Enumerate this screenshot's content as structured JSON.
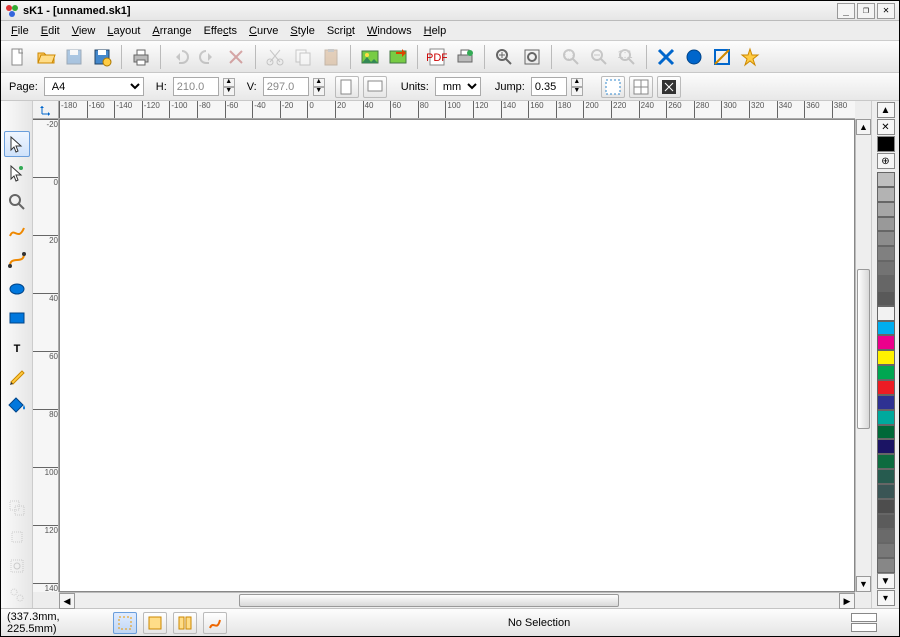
{
  "title": "sK1 - [unnamed.sk1]",
  "menu": [
    "File",
    "Edit",
    "View",
    "Layout",
    "Arrange",
    "Effects",
    "Curve",
    "Style",
    "Script",
    "Windows",
    "Help"
  ],
  "toolbar1": {
    "new": "doc-new-icon",
    "open": "doc-open-icon",
    "save": "doc-save-icon",
    "saveas": "doc-saveas-icon",
    "print": "print-icon",
    "undo": "undo-icon",
    "redo": "redo-icon",
    "delete": "delete-icon",
    "cut": "cut-icon",
    "copy": "copy-icon",
    "paste": "paste-icon",
    "import": "import-image-icon",
    "export": "export-image-icon",
    "pdf": "pdf-export-icon",
    "printps": "print-ps-icon",
    "zoomin": "zoom-in-icon",
    "zoomfit": "zoom-fit-icon",
    "zoomsel": "zoom-selection-icon",
    "zoomout": "zoom-out-icon",
    "zoom100": "zoom-100-icon",
    "nofill": "no-fill-icon",
    "fill": "fill-icon",
    "outline": "outline-icon",
    "star": "favorite-icon"
  },
  "propbar": {
    "page_label": "Page:",
    "page_value": "A4",
    "h_label": "H:",
    "h_value": "210.0",
    "v_label": "V:",
    "v_value": "297.0",
    "portrait": "portrait-icon",
    "landscape": "landscape-icon",
    "units_label": "Units:",
    "units_value": "mm",
    "jump_label": "Jump:",
    "jump_value": "0.35",
    "guides": "guides-icon",
    "snapgrid": "snap-grid-icon",
    "snapobj": "snap-object-icon"
  },
  "tools": {
    "select": "select-tool",
    "shaper": "shaper-tool",
    "zoom": "zoom-tool",
    "freehand": "freehand-tool",
    "bezier": "bezier-tool",
    "ellipse": "ellipse-tool",
    "rect": "rectangle-tool",
    "text": "text-tool",
    "outline": "outline-tool",
    "fill": "fill-tool",
    "d1": "combine-tool",
    "d2": "break-tool",
    "d3": "group-tool",
    "d4": "ungroup-tool"
  },
  "ruler": {
    "h_start": -180,
    "h_end": 400,
    "h_step": 20,
    "v_start": -20,
    "v_end": 140,
    "v_step": 20
  },
  "palette": [
    "#bfbfbf",
    "#b3b3b3",
    "#a6a6a6",
    "#999999",
    "#8c8c8c",
    "#808080",
    "#737373",
    "#666666",
    "#595959",
    "#f2f2f2",
    "#00aeef",
    "#ec008c",
    "#fff200",
    "#00a651",
    "#ed1c24",
    "#2e3192",
    "#00a99d",
    "#006838",
    "#1b1464",
    "#0d6b3f",
    "#265b4f",
    "#3a5555",
    "#4d4d4d",
    "#5b5b5b",
    "#6a6a6a",
    "#787878",
    "#878787"
  ],
  "rightcol": {
    "up": "▲",
    "x": "✕",
    "box": "■",
    "reg": "⊕",
    "down": "▼",
    "menu": "▾"
  },
  "status": {
    "coords": "(337.3mm, 225.5mm)",
    "b1": "snap-page-icon",
    "b2": "snap-guide-icon",
    "b3": "snap-grid-icon",
    "b4": "snap-object-icon",
    "message": "No Selection"
  }
}
